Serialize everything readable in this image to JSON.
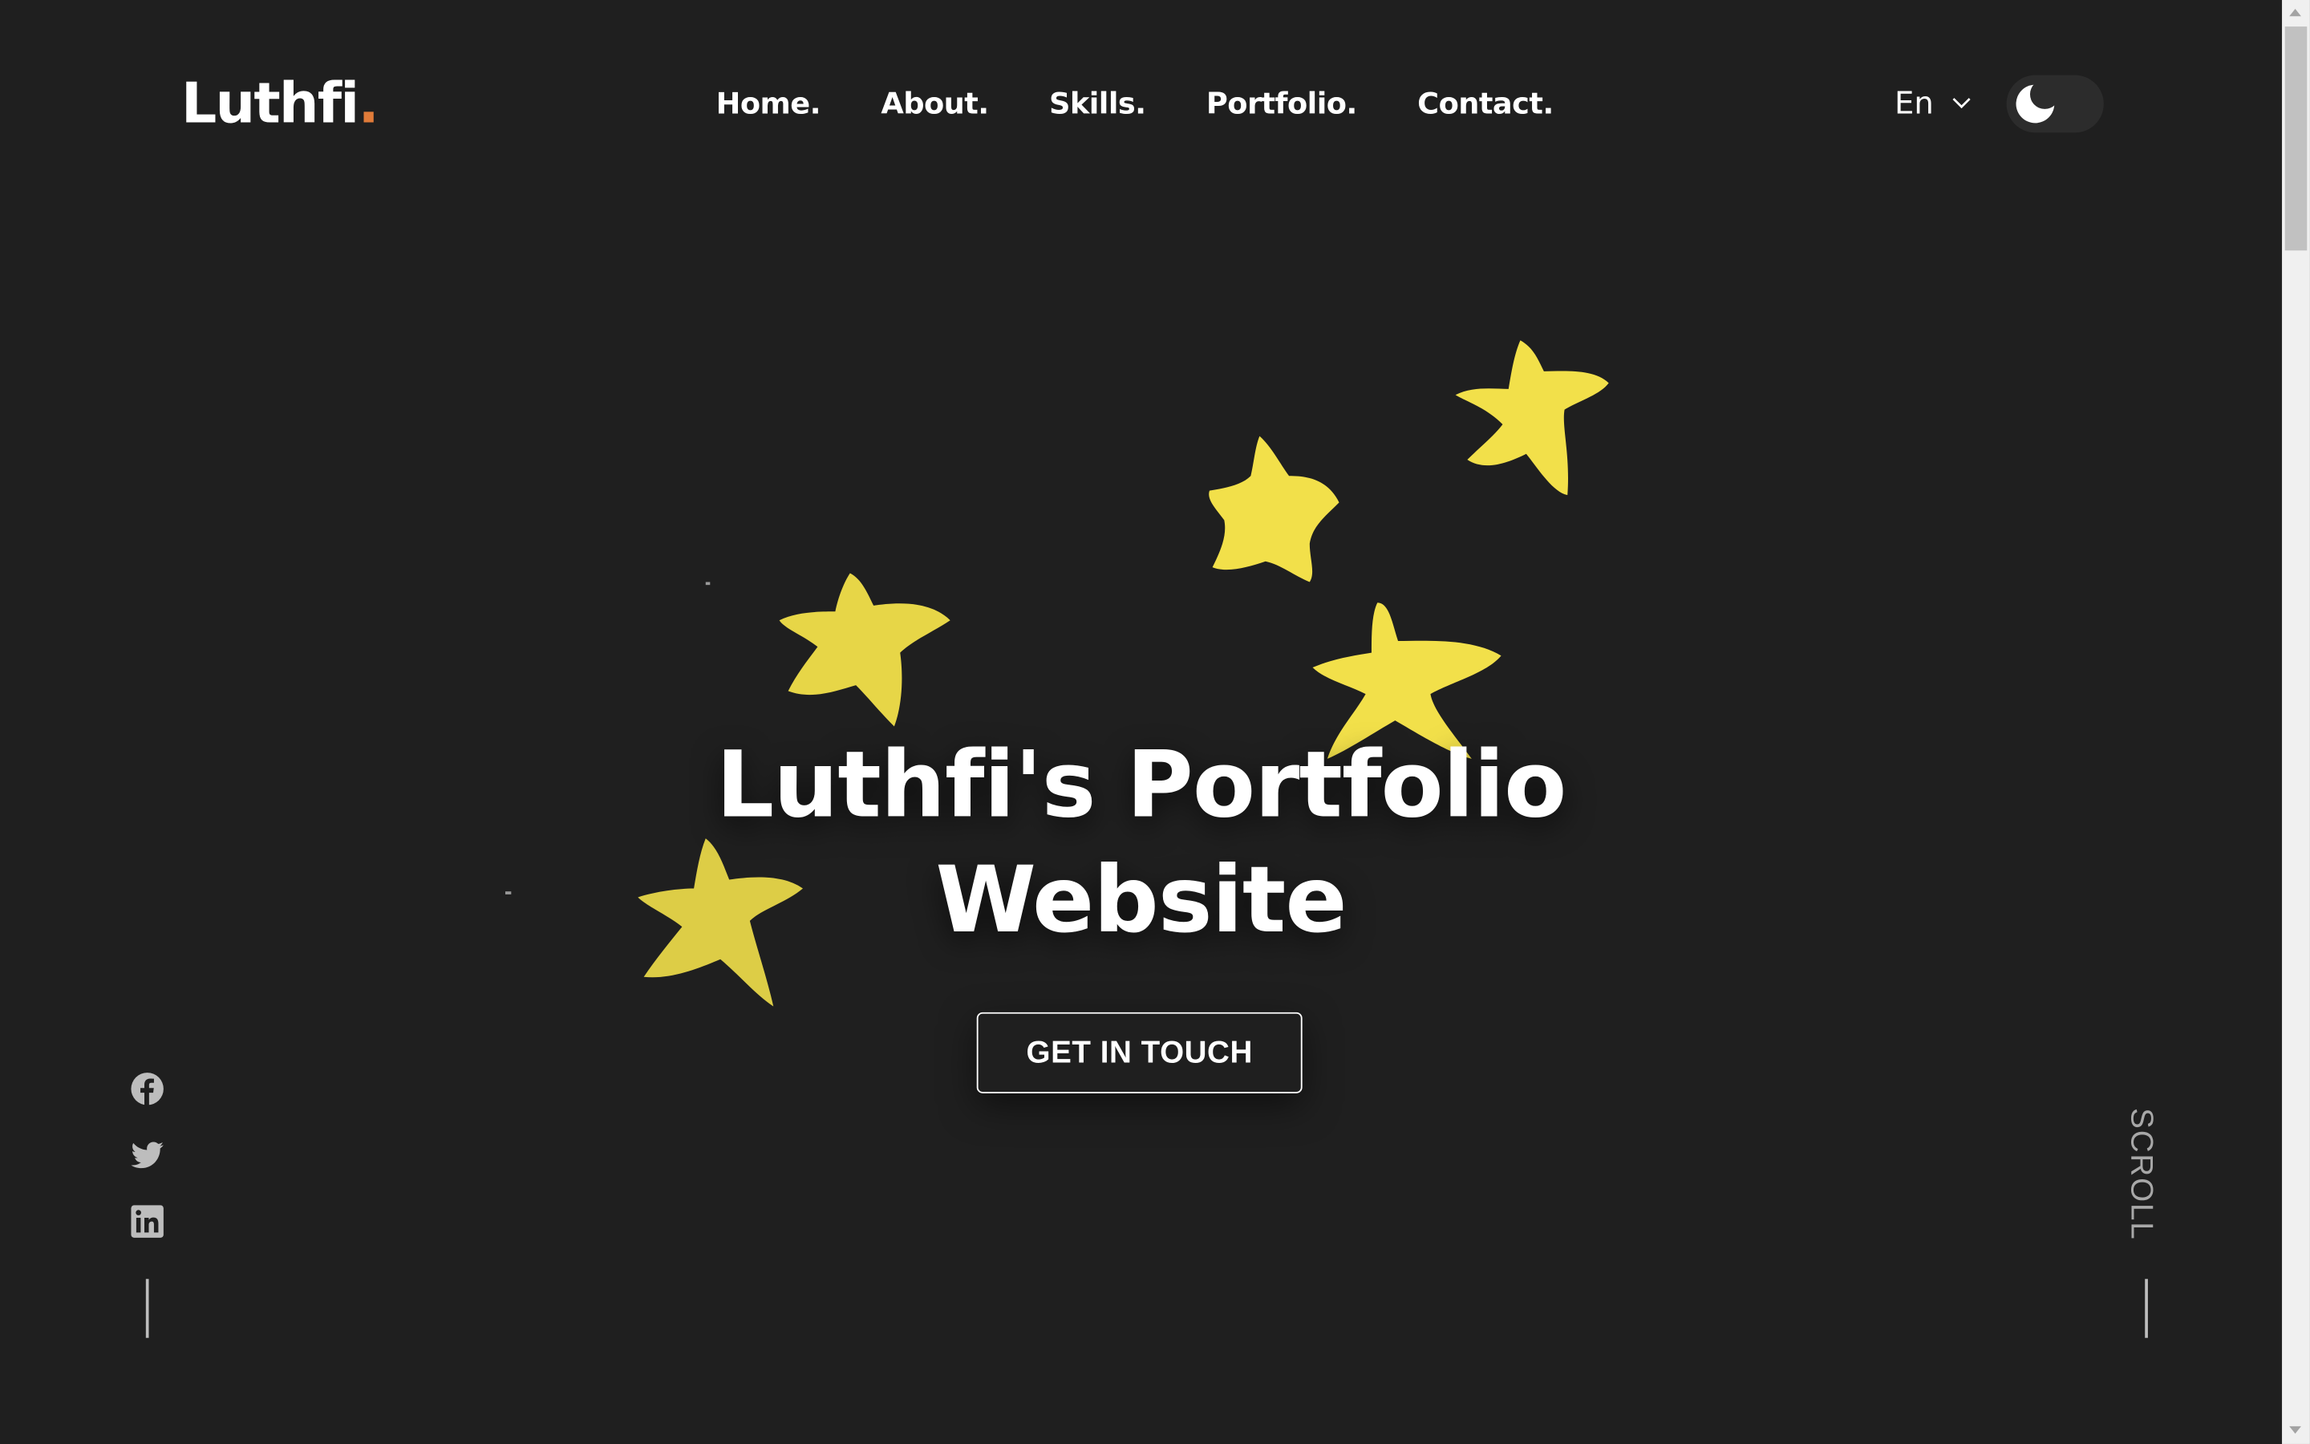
{
  "brand": {
    "name": "Luthfi",
    "dot": ".",
    "accent_color": "#e07b39"
  },
  "nav": {
    "items": [
      {
        "label": "Home."
      },
      {
        "label": "About."
      },
      {
        "label": "Skills."
      },
      {
        "label": "Portfolio."
      },
      {
        "label": "Contact."
      }
    ]
  },
  "language": {
    "selected": "En",
    "icon": "chevron-down-icon"
  },
  "theme_toggle": {
    "mode": "dark",
    "icon": "moon-icon"
  },
  "hero": {
    "title_line1": "Luthfi's Portfolio",
    "title_line2": "Website",
    "cta_label": "GET IN TOUCH",
    "decoration_color": "#f2e04a"
  },
  "social": [
    {
      "icon": "facebook-icon"
    },
    {
      "icon": "twitter-icon"
    },
    {
      "icon": "linkedin-icon"
    }
  ],
  "scroll_indicator": {
    "label": "SCROLL"
  },
  "colors": {
    "background": "#1f1f1f",
    "text": "#ffffff",
    "muted": "#a8a8a8"
  }
}
